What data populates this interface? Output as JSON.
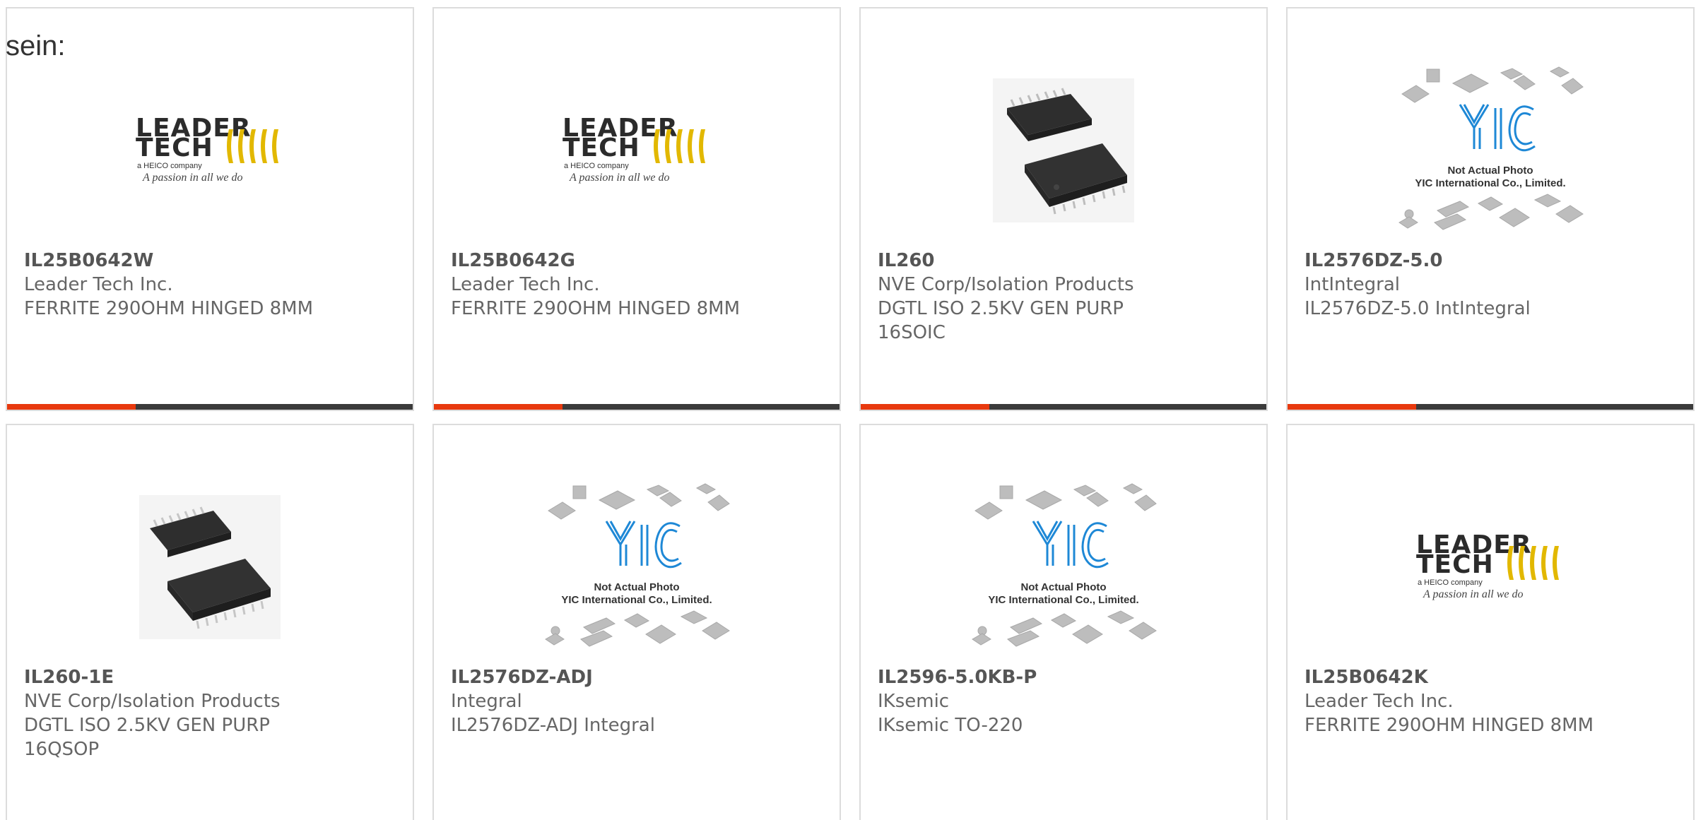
{
  "intro_text": "sein:",
  "logos": {
    "leader_tech": {
      "line1": "LEADER",
      "line2": "TECH",
      "sub": "a HEICO company",
      "tagline": "A passion in all we do"
    },
    "yic": {
      "monogram": "YIC",
      "line1": "Not Actual Photo",
      "line2": "YIC International Co., Limited."
    }
  },
  "colors": {
    "accent": "#e8390e",
    "bar": "#3b3b3b",
    "yic_blue": "#1e88d6"
  },
  "products": [
    {
      "part_no": "IL25B0642W",
      "manufacturer": "Leader Tech Inc.",
      "desc_lines": [
        "FERRITE 290OHM HINGED 8MM"
      ],
      "image": "leader-tech-logo"
    },
    {
      "part_no": "IL25B0642G",
      "manufacturer": "Leader Tech Inc.",
      "desc_lines": [
        "FERRITE 290OHM HINGED 8MM"
      ],
      "image": "leader-tech-logo"
    },
    {
      "part_no": "IL260",
      "manufacturer": "NVE Corp/Isolation Products",
      "desc_lines": [
        "DGTL ISO 2.5KV GEN PURP",
        "16SOIC"
      ],
      "image": "soic-chip-photo"
    },
    {
      "part_no": "IL2576DZ-5.0",
      "manufacturer": "IntIntegral",
      "desc_lines": [
        "IL2576DZ-5.0 IntIntegral"
      ],
      "image": "yic-placeholder"
    },
    {
      "part_no": "IL260-1E",
      "manufacturer": "NVE Corp/Isolation Products",
      "desc_lines": [
        "DGTL ISO 2.5KV GEN PURP",
        "16QSOP"
      ],
      "image": "qsop-chip-photo"
    },
    {
      "part_no": "IL2576DZ-ADJ",
      "manufacturer": "Integral",
      "desc_lines": [
        "IL2576DZ-ADJ Integral"
      ],
      "image": "yic-placeholder"
    },
    {
      "part_no": "IL2596-5.0KB-P",
      "manufacturer": "IKsemic",
      "desc_lines": [
        "IKsemic TO-220"
      ],
      "image": "yic-placeholder"
    },
    {
      "part_no": "IL25B0642K",
      "manufacturer": "Leader Tech Inc.",
      "desc_lines": [
        "FERRITE 290OHM HINGED 8MM"
      ],
      "image": "leader-tech-logo"
    }
  ]
}
